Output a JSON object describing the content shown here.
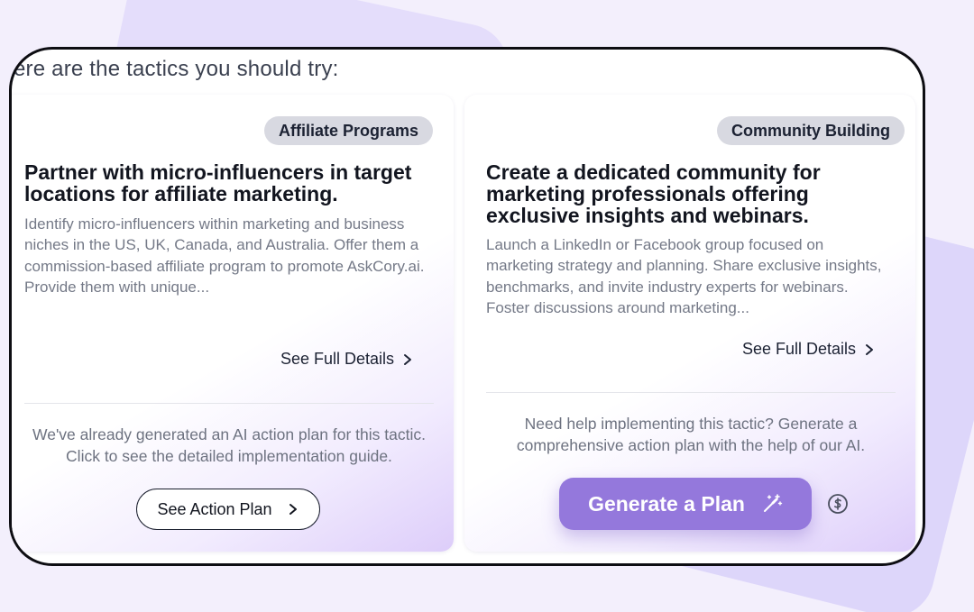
{
  "heading": "ere are the tactics you should try:",
  "cards": [
    {
      "tag": "Affiliate Programs",
      "title": "Partner with micro-influencers in target locations for affiliate marketing.",
      "description": "Identify micro-influencers within marketing and business niches in the US, UK, Canada, and Australia. Offer them a commission-based affiliate program to promote AskCory.ai. Provide them with unique...",
      "details_link": "See Full Details",
      "note": "We've already generated an AI action plan for this tactic. Click to see the detailed implementation guide.",
      "button": "See Action Plan"
    },
    {
      "tag": "Community Building",
      "title": "Create a dedicated community for marketing professionals offering exclusive insights and webinars.",
      "description": "Launch a LinkedIn or Facebook group focused on marketing strategy and planning. Share exclusive insights, benchmarks, and invite industry experts for webinars. Foster discussions around marketing...",
      "details_link": "See Full Details",
      "note": "Need help implementing this tactic? Generate a comprehensive action plan with the help of our AI.",
      "button": "Generate a Plan"
    }
  ],
  "icons": {
    "chevron": "chevron-right-icon",
    "magic": "magic-wand-icon",
    "credit": "dollar-coin-icon"
  },
  "colors": {
    "accent": "#9478dc",
    "tag_bg": "#d8d9e1",
    "background": "#f3effc"
  }
}
